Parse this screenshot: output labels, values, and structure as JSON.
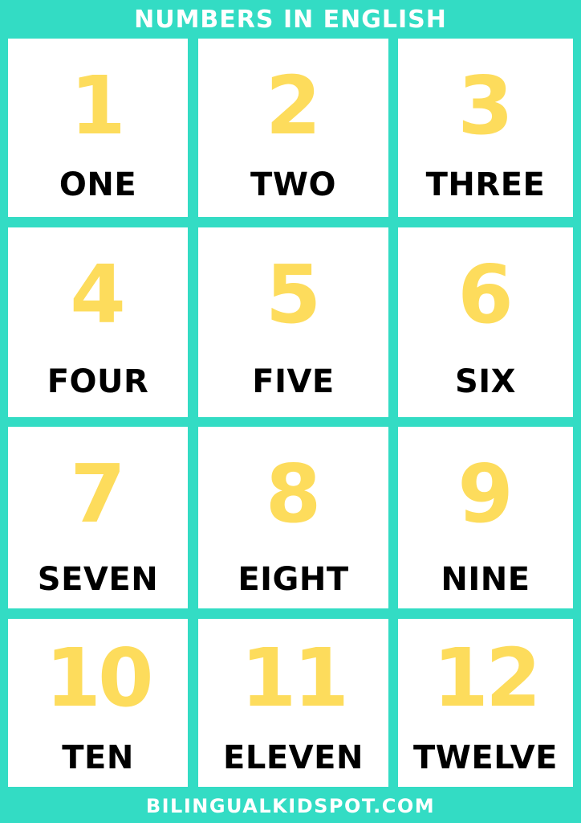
{
  "title": "NUMBERS IN ENGLISH",
  "footer": "BILINGUALKIDSPOT.COM",
  "colors": {
    "background": "#33dcc4",
    "card": "#ffffff",
    "digit": "#fddc5c",
    "word": "#000000"
  },
  "cards": [
    {
      "digit": "1",
      "word": "ONE"
    },
    {
      "digit": "2",
      "word": "TWO"
    },
    {
      "digit": "3",
      "word": "THREE"
    },
    {
      "digit": "4",
      "word": "FOUR"
    },
    {
      "digit": "5",
      "word": "FIVE"
    },
    {
      "digit": "6",
      "word": "SIX"
    },
    {
      "digit": "7",
      "word": "SEVEN"
    },
    {
      "digit": "8",
      "word": "EIGHT"
    },
    {
      "digit": "9",
      "word": "NINE"
    },
    {
      "digit": "10",
      "word": "TEN"
    },
    {
      "digit": "11",
      "word": "ELEVEN"
    },
    {
      "digit": "12",
      "word": "TWELVE"
    }
  ]
}
